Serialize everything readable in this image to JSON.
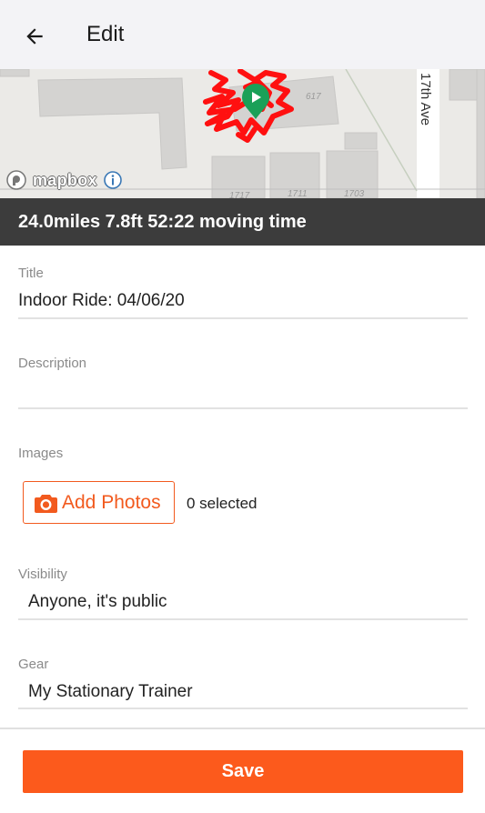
{
  "header": {
    "title": "Edit",
    "back_icon": "arrow-left-icon"
  },
  "map": {
    "attribution": "mapbox",
    "street_label": "17th Ave",
    "building_numbers": [
      "617",
      "1717",
      "1711",
      "1703"
    ],
    "route_color": "#ff0000",
    "marker_color": "#1aa058"
  },
  "stats": {
    "summary": "24.0miles 7.8ft 52:22 moving time"
  },
  "form": {
    "title_label": "Title",
    "title_value": "Indoor Ride: 04/06/20",
    "description_label": "Description",
    "description_value": "",
    "images_label": "Images",
    "add_photos_label": "Add Photos",
    "selected_count": "0 selected",
    "visibility_label": "Visibility",
    "visibility_value": "Anyone, it's public",
    "gear_label": "Gear",
    "gear_value": "My Stationary Trainer"
  },
  "footer": {
    "save_label": "Save"
  },
  "colors": {
    "accent": "#fc5a1c",
    "stats_bg": "#3c3c3c",
    "appbar_bg": "#f3f3f6"
  }
}
